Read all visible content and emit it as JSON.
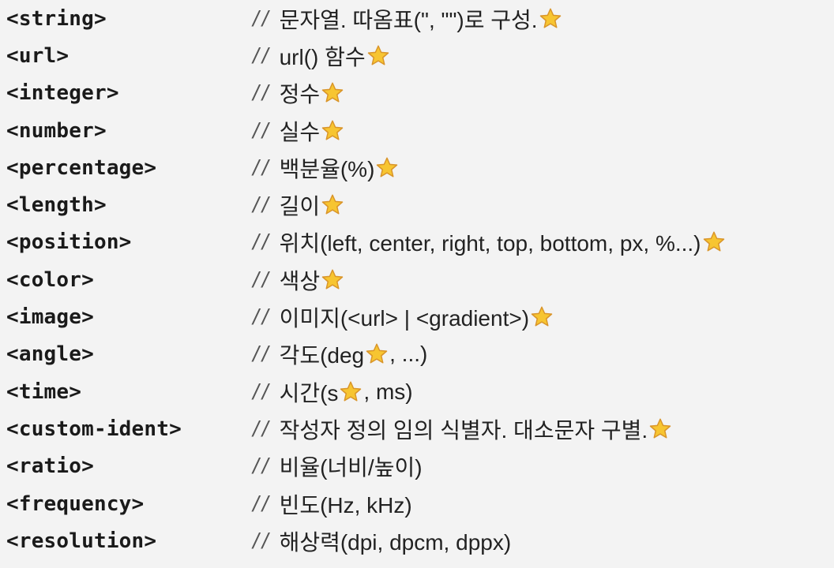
{
  "separator": "//",
  "colors": {
    "background": "#f3f3f3",
    "text": "#1a1a1a",
    "star_fill": "#f7c531",
    "star_stroke": "#d9952a"
  },
  "icon": "star-icon",
  "rows": [
    {
      "type": "<string>",
      "parts": [
        "문자열. 따옴표(\", \"\")로 구성.",
        "star"
      ]
    },
    {
      "type": "<url>",
      "parts": [
        "url() 함수",
        "star"
      ]
    },
    {
      "type": "<integer>",
      "parts": [
        "정수",
        "star"
      ]
    },
    {
      "type": "<number>",
      "parts": [
        "실수",
        "star"
      ]
    },
    {
      "type": "<percentage>",
      "parts": [
        "백분율(%)",
        "star"
      ]
    },
    {
      "type": "<length>",
      "parts": [
        "길이",
        "star"
      ]
    },
    {
      "type": "<position>",
      "parts": [
        "위치(left, center, right, top, bottom, px, %...)",
        "star"
      ]
    },
    {
      "type": "<color>",
      "parts": [
        "색상",
        "star"
      ]
    },
    {
      "type": "<image>",
      "parts": [
        "이미지(<url> | <gradient>)",
        "star"
      ]
    },
    {
      "type": "<angle>",
      "parts": [
        "각도(deg",
        "star",
        ", ...)"
      ]
    },
    {
      "type": "<time>",
      "parts": [
        "시간(s",
        "star",
        ", ms)"
      ]
    },
    {
      "type": "<custom-ident>",
      "parts": [
        "작성자 정의 임의 식별자. 대소문자 구별.",
        "star"
      ]
    },
    {
      "type": "<ratio>",
      "parts": [
        "비율(너비/높이)"
      ]
    },
    {
      "type": "<frequency>",
      "parts": [
        "빈도(Hz, kHz)"
      ]
    },
    {
      "type": "<resolution>",
      "parts": [
        "해상력(dpi, dpcm, dppx)"
      ]
    }
  ]
}
